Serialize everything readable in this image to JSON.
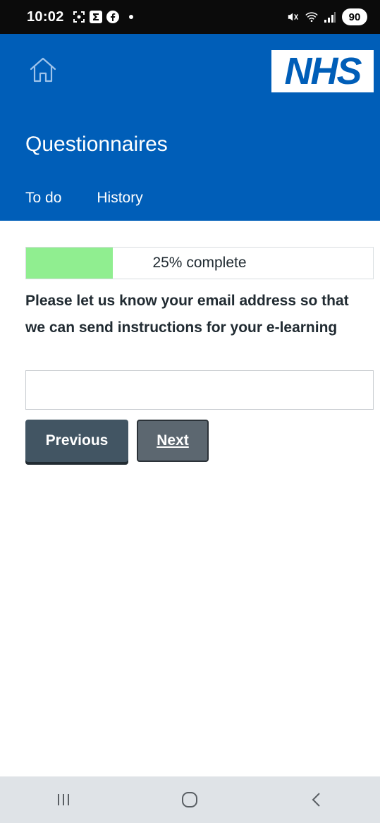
{
  "status_bar": {
    "time": "10:02",
    "battery": "90",
    "icons": [
      "screenshot-icon",
      "sigma-icon",
      "facebook-icon",
      "mute-icon",
      "wifi-icon",
      "signal-icon"
    ]
  },
  "header": {
    "logo_text": "NHS",
    "title": "Questionnaires",
    "tabs": [
      {
        "label": "To do"
      },
      {
        "label": "History"
      }
    ],
    "colors": {
      "brand": "#005eb8"
    }
  },
  "progress": {
    "percent": 25,
    "label": "25% complete",
    "fill_color": "#90ee90"
  },
  "question": {
    "text": "Please let us know your email address so that we can send instructions for your e-learning"
  },
  "email_input": {
    "value": "",
    "placeholder": ""
  },
  "buttons": {
    "previous": "Previous",
    "next": "Next"
  }
}
